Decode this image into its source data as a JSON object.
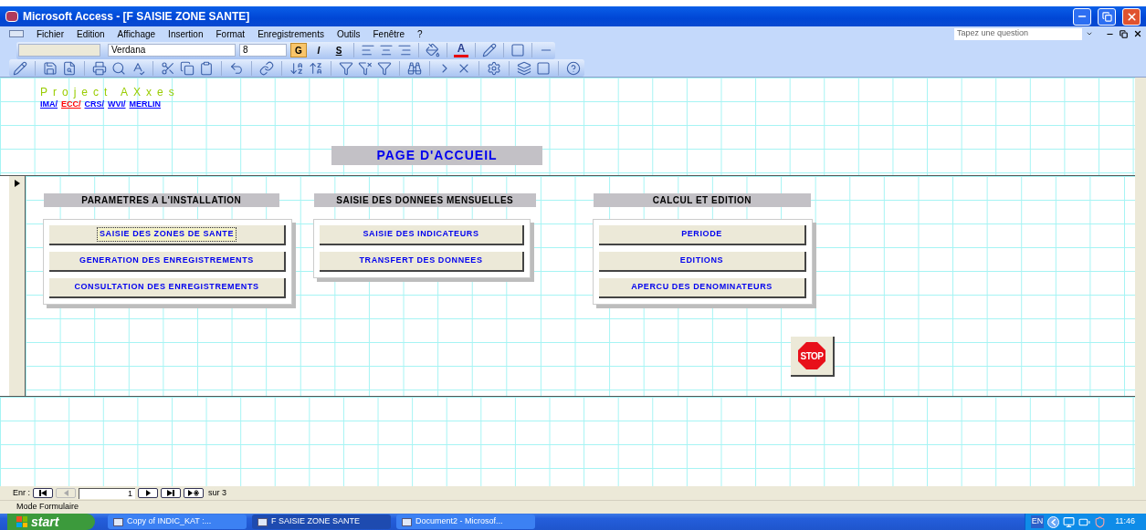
{
  "window": {
    "title": "Microsoft Access - [F SAISIE ZONE SANTE]"
  },
  "menu": {
    "items": [
      "Fichier",
      "Edition",
      "Affichage",
      "Insertion",
      "Format",
      "Enregistrements",
      "Outils",
      "Fenêtre",
      "?"
    ],
    "help_box": {
      "placeholder": "Tapez une question"
    }
  },
  "format_toolbar": {
    "font": "Verdana",
    "size": "8",
    "font_color_label": "A",
    "style_buttons": [
      {
        "label": "G",
        "selected": true
      },
      {
        "label": "I",
        "selected": false
      },
      {
        "label": "S",
        "selected": false
      }
    ]
  },
  "form": {
    "project_title": "Project AXxes",
    "links": [
      {
        "label": "IMA/",
        "color": "#0000ff"
      },
      {
        "label": "ECC/",
        "color": "#ff0000"
      },
      {
        "label": "CRS/",
        "color": "#0000ff"
      },
      {
        "label": "WVI/",
        "color": "#0000ff"
      },
      {
        "label": "MERLIN",
        "color": "#0000ff"
      }
    ],
    "page_title": "PAGE D'ACCUEIL",
    "sections": [
      {
        "heading": "PARAMETRES A L'INSTALLATION",
        "buttons": [
          {
            "label": "SAISIE DES ZONES DE SANTE",
            "focused": true
          },
          {
            "label": "GENERATION DES ENREGISTREMENTS",
            "focused": false
          },
          {
            "label": "CONSULTATION DES ENREGISTREMENTS",
            "focused": false
          }
        ]
      },
      {
        "heading": "SAISIE DES DONNEES MENSUELLES",
        "buttons": [
          {
            "label": "SAISIE DES INDICATEURS",
            "focused": false
          },
          {
            "label": "TRANSFERT DES DONNEES",
            "focused": false
          }
        ]
      },
      {
        "heading": "CALCUL ET EDITION",
        "buttons": [
          {
            "label": "PERIODE",
            "focused": false
          },
          {
            "label": "EDITIONS",
            "focused": false
          },
          {
            "label": "APERCU  DES DENOMINATEURS",
            "focused": false
          }
        ]
      }
    ],
    "stop_button": {
      "label": "STOP"
    }
  },
  "navigation": {
    "label": "Enr :",
    "record": "1",
    "total": "sur 3"
  },
  "status_bar": {
    "text": "Mode Formulaire"
  },
  "taskbar": {
    "start": "start",
    "tasks": [
      {
        "label": "Copy of INDIC_KAT :...",
        "selected": false
      },
      {
        "label": "F SAISIE ZONE SANTE",
        "selected": true
      },
      {
        "label": "Document2 - Microsof...",
        "selected": false
      }
    ],
    "language": "EN",
    "clock": "11:46"
  }
}
